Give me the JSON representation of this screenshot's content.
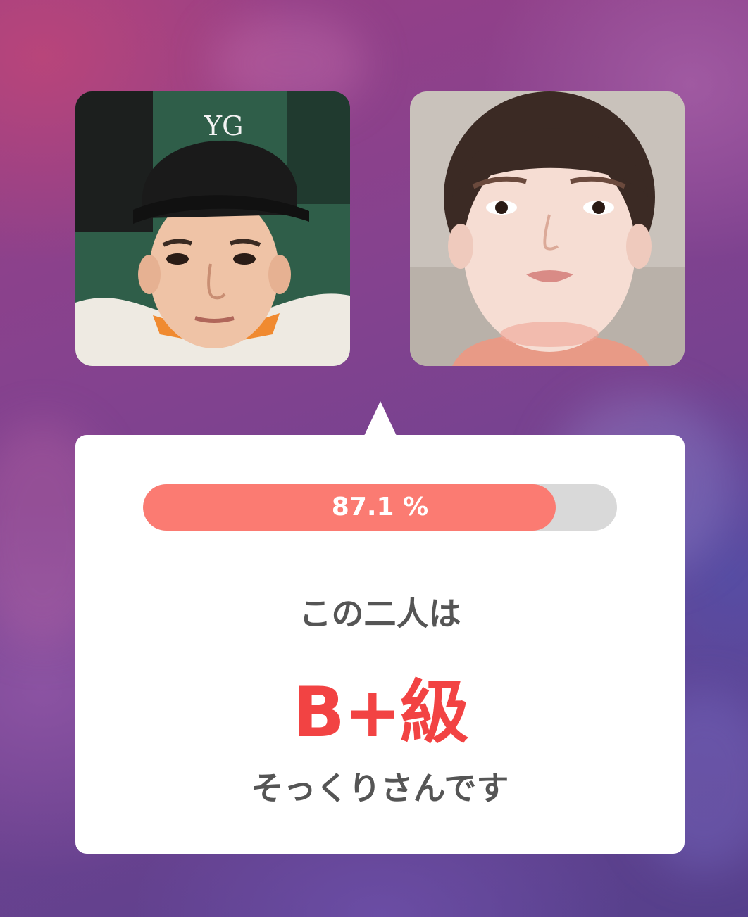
{
  "result": {
    "similarity_label": "87.1 %",
    "similarity_fraction": 0.871,
    "intro_text": "この二人は",
    "grade": "B+級",
    "outro_text": "そっくりさんです"
  },
  "colors": {
    "progress_fill": "#fb7b72",
    "progress_track": "#d9d9d9",
    "grade": "#f24343",
    "body_text": "#555555",
    "card": "#ffffff"
  },
  "images": {
    "left_photo_icon": "person-photo-icon",
    "right_photo_icon": "person-photo-icon"
  }
}
